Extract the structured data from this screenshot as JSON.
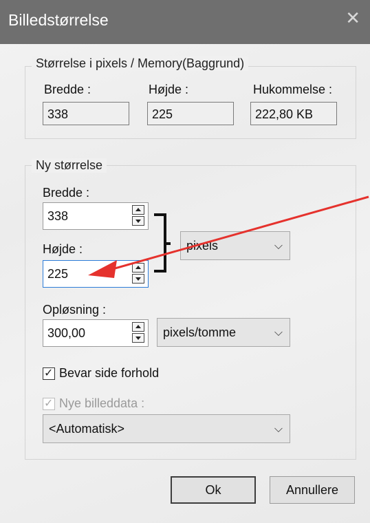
{
  "window": {
    "title": "Billedstørrelse",
    "close_glyph": "✕"
  },
  "size_group": {
    "legend": "Størrelse i pixels / Memory(Baggrund)",
    "width_label": "Bredde :",
    "width_value": "338",
    "height_label": "Højde :",
    "height_value": "225",
    "memory_label": "Hukommelse :",
    "memory_value": "222,80 KB"
  },
  "new_size_group": {
    "legend": "Ny størrelse",
    "width_label": "Bredde :",
    "width_value": "338",
    "height_label": "Højde :",
    "height_value": "225",
    "unit_value": "pixels",
    "resolution_label": "Opløsning :",
    "resolution_value": "300,00",
    "resolution_unit": "pixels/tomme",
    "keep_aspect_label": "Bevar side forhold",
    "keep_aspect_checked": true,
    "new_data_label": "Nye billeddata :",
    "new_data_checked": true,
    "new_data_enabled": false,
    "resample_value": "<Automatisk>"
  },
  "buttons": {
    "ok": "Ok",
    "cancel": "Annullere"
  },
  "icons": {
    "close": "close-icon",
    "chevron": "chevron-down-icon",
    "check": "checkmark-icon",
    "arrow": "red-arrow-annotation"
  },
  "colors": {
    "titlebar": "#6f6f6f",
    "focus_border": "#2b7bd8",
    "annotation_arrow": "#e5322d"
  }
}
